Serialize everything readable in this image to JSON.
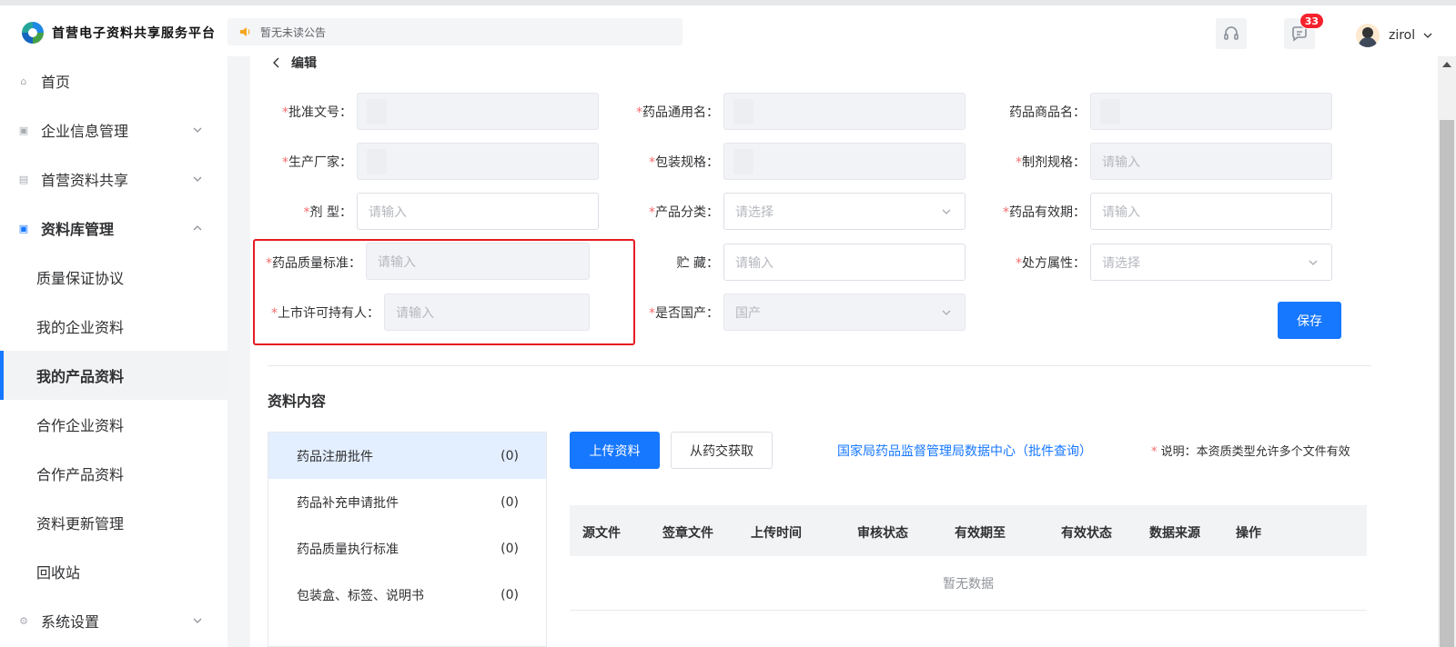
{
  "header": {
    "app_title": "首营电子资料共享服务平台",
    "notice": "暂无未读公告",
    "message_count": "33",
    "username": "zirol"
  },
  "sidebar": {
    "items": [
      {
        "label": "首页",
        "icon": "home-icon"
      },
      {
        "label": "企业信息管理",
        "icon": "enterprise-icon"
      },
      {
        "label": "首营资料共享",
        "icon": "share-icon"
      },
      {
        "label": "资料库管理",
        "icon": "library-icon"
      },
      {
        "label": "质量保证协议"
      },
      {
        "label": "我的企业资料"
      },
      {
        "label": "我的产品资料"
      },
      {
        "label": "合作企业资料"
      },
      {
        "label": "合作产品资料"
      },
      {
        "label": "资料更新管理"
      },
      {
        "label": "回收站"
      },
      {
        "label": "系统设置",
        "icon": "settings-icon"
      }
    ],
    "active": "我的产品资料"
  },
  "form": {
    "back_label": "编辑",
    "fields": {
      "approval_no": {
        "label": "批准文号：",
        "required": "*",
        "value": ""
      },
      "generic_name": {
        "label": "药品通用名：",
        "required": "*",
        "value": ""
      },
      "trade_name": {
        "label": "药品商品名：",
        "value": ""
      },
      "manufacturer": {
        "label": "生产厂家：",
        "required": "*",
        "value": ""
      },
      "package_spec": {
        "label": "包装规格：",
        "required": "*",
        "value": ""
      },
      "preparation_spec": {
        "label": "制剂规格：",
        "required": "*",
        "placeholder": "请输入"
      },
      "dosage_form": {
        "label": "剂 型：",
        "required": "*",
        "placeholder": "请输入"
      },
      "category": {
        "label": "产品分类：",
        "required": "*",
        "placeholder": "请选择"
      },
      "validity": {
        "label": "药品有效期：",
        "required": "*",
        "placeholder": "请输入"
      },
      "quality_standard": {
        "label": "药品质量标准：",
        "required": "*",
        "placeholder": "请输入"
      },
      "storage": {
        "label": "贮 藏：",
        "placeholder": "请输入"
      },
      "prescription": {
        "label": "处方属性：",
        "required": "*",
        "placeholder": "请选择"
      },
      "mah": {
        "label": "上市许可持有人：",
        "required": "*",
        "placeholder": "请输入"
      },
      "domestic": {
        "label": "是否国产：",
        "required": "*",
        "value": "国产"
      }
    },
    "save_label": "保存"
  },
  "materials": {
    "title": "资料内容",
    "categories": [
      {
        "label": "药品注册批件",
        "count": "(0)"
      },
      {
        "label": "药品补充申请批件",
        "count": "(0)"
      },
      {
        "label": "药品质量执行标准",
        "count": "(0)"
      },
      {
        "label": "包装盒、标签、说明书",
        "count": "(0)"
      }
    ],
    "upload_label": "上传资料",
    "fetch_label": "从药交获取",
    "link_label": "国家局药品监督管理局数据中心（批件查询）",
    "note_mark": "*",
    "note_text": " 说明：本资质类型允许多个文件有效",
    "columns": [
      "源文件",
      "签章文件",
      "上传时间",
      "审核状态",
      "有效期至",
      "有效状态",
      "数据来源",
      "操作"
    ],
    "empty_text": "暂无数据"
  },
  "colors": {
    "primary": "#1677ff",
    "required": "#f56c6c",
    "highlight": "#e51c23",
    "badge": "#f5222d"
  }
}
